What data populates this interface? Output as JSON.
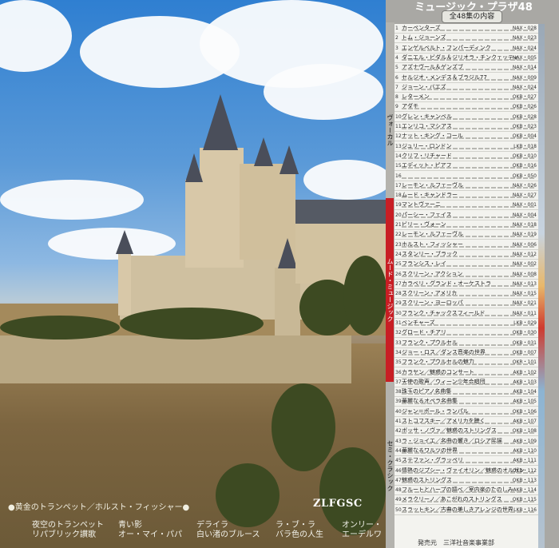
{
  "album": {
    "series_title": "ミュージック・プラザ48",
    "series_subtitle": "全48集の内容",
    "logo": "ZLFGSC",
    "featured": "●黄金のトランペット／ホルスト・フィッシャー●",
    "bottom_text": "発売元　三洋社音楽事業部"
  },
  "featured_tracks": [
    "夜空のトランペット",
    "青い影",
    "デライラ",
    "ラ・ブ・ラ",
    "オンリー・",
    "リパブリック讃歌",
    "オー・マイ・パパ",
    "白い渚のブルース",
    "バラ色の人生",
    "エーデルワ"
  ],
  "sections": {
    "vocal": "ヴォーカル",
    "mood": "ムード・ミュージック",
    "semiclassic": "セミ・クラシック"
  },
  "catalog": [
    {
      "n": "1",
      "title": "カーペンターズ",
      "code": "NAX・028"
    },
    {
      "n": "2",
      "title": "トム・ジョーンズ",
      "code": "NAX・023"
    },
    {
      "n": "3",
      "title": "エンゲルベルト・フンパーディンク",
      "code": "NAX・024"
    },
    {
      "n": "4",
      "title": "ダニエル・ビダル＆ジリオラ・チンクェッティ",
      "code": "NAX・005"
    },
    {
      "n": "5",
      "title": "アズナヴール＆ゲンズブ",
      "code": "NAX・014"
    },
    {
      "n": "6",
      "title": "セルジオ・メンデス＆ブラジル77",
      "code": "NAX・009"
    },
    {
      "n": "7",
      "title": "ジョーン・バエズ",
      "code": "NAX・024"
    },
    {
      "n": "8",
      "title": "レターメン",
      "code": "OKB・027"
    },
    {
      "n": "9",
      "title": "アダモ",
      "code": "OKB・026"
    },
    {
      "n": "10",
      "title": "グレン・キャンベル",
      "code": "OKB・028"
    },
    {
      "n": "11",
      "title": "エンリコ・マシアス",
      "code": "OKB・023"
    },
    {
      "n": "12",
      "title": "ナット・キング・コール",
      "code": "OKB・004"
    },
    {
      "n": "13",
      "title": "ジュリー・ロンドン",
      "code": "LKB・018"
    },
    {
      "n": "14",
      "title": "クリフ・リチャード",
      "code": "OKB・010"
    },
    {
      "n": "15",
      "title": "エディット・ピアフ",
      "code": "OKB・016"
    },
    {
      "n": "16",
      "title": "",
      "code": "OKB・050"
    },
    {
      "n": "17",
      "title": "レーモン・ルフェーヴル",
      "code": "NAX・026"
    },
    {
      "n": "18",
      "title": "ムード・キャンドラー",
      "code": "NAX・027"
    },
    {
      "n": "19",
      "title": "マントヴァーニ",
      "code": "NAX・001"
    },
    {
      "n": "20",
      "title": "パーシー・フェイス",
      "code": "NAX・004"
    },
    {
      "n": "21",
      "title": "ビリー・ヴォーン",
      "code": "NAX・018"
    },
    {
      "n": "22",
      "title": "レーモン・ルフェーヴル",
      "code": "NAX・019"
    },
    {
      "n": "23",
      "title": "ホルスト・フィッシャー",
      "code": "NAX・006"
    },
    {
      "n": "24",
      "title": "スタンリー・ブラック",
      "code": "NAX・012"
    },
    {
      "n": "25",
      "title": "フランシス・レイ",
      "code": "NAX・002"
    },
    {
      "n": "26",
      "title": "スクリーン・アクション",
      "code": "NAX・008"
    },
    {
      "n": "27",
      "title": "カラベリ・グランド・オーケストラ",
      "code": "NAX・013"
    },
    {
      "n": "28",
      "title": "スクリーン・アメリカ",
      "code": "NAX・015"
    },
    {
      "n": "29",
      "title": "スクリーン・ヨーロッパ",
      "code": "NAX・021"
    },
    {
      "n": "30",
      "title": "フランク・チャックスフィールド",
      "code": "NAX・011"
    },
    {
      "n": "31",
      "title": "ベンチャーズ",
      "code": "LKB・029"
    },
    {
      "n": "32",
      "title": "グロード・チアリ",
      "code": "OKB・030"
    },
    {
      "n": "33",
      "title": "フランク・プウルセル",
      "code": "OKB・031"
    },
    {
      "n": "34",
      "title": "ジョー・ロス／ダンス音楽の世界",
      "code": "OKB・007"
    },
    {
      "n": "35",
      "title": "フランク・プウルセルの魅力",
      "code": "OKR・101"
    },
    {
      "n": "36",
      "title": "カラヤン／魅惑のコンサート",
      "code": "AKB・102"
    },
    {
      "n": "37",
      "title": "天使の歌声／ウィーン少年合唱団",
      "code": "AKB・103"
    },
    {
      "n": "38",
      "title": "珠玉のピアノ名曲集",
      "code": "AKB・104"
    },
    {
      "n": "39",
      "title": "華麗なるオペラ名曲集",
      "code": "AKB・105"
    },
    {
      "n": "40",
      "title": "ジャン＝ポール・ランパル",
      "code": "OKB・106"
    },
    {
      "n": "41",
      "title": "ストコフスキー／アメリカを聴く",
      "code": "AKB・107"
    },
    {
      "n": "42",
      "title": "ボッサ・ノヴァ／魅惑のストリングス",
      "code": "OKB・108"
    },
    {
      "n": "43",
      "title": "ラ・ジョイエ／名曲の響き／ロシア民謡",
      "code": "AKB・109"
    },
    {
      "n": "44",
      "title": "華麗なるワルツの世界",
      "code": "AKB・110"
    },
    {
      "n": "45",
      "title": "ステファン・グラッペリ",
      "code": "AKB・111"
    },
    {
      "n": "46",
      "title": "情熱のジプシー・ヴァイオリン／魅惑のオルガン",
      "code": "OKB・112"
    },
    {
      "n": "47",
      "title": "魅惑のストリングス",
      "code": "OKB・113"
    },
    {
      "n": "48",
      "title": "フルートとハープの調べ／室内楽のたのしみ",
      "code": "AKB・114"
    },
    {
      "n": "49",
      "title": "メラクリーノ／あこがれのストリングス",
      "code": "OKB・115"
    },
    {
      "n": "50",
      "title": "スラットキン／古典の美しきアレンジの世界",
      "code": "LKB・116"
    }
  ]
}
